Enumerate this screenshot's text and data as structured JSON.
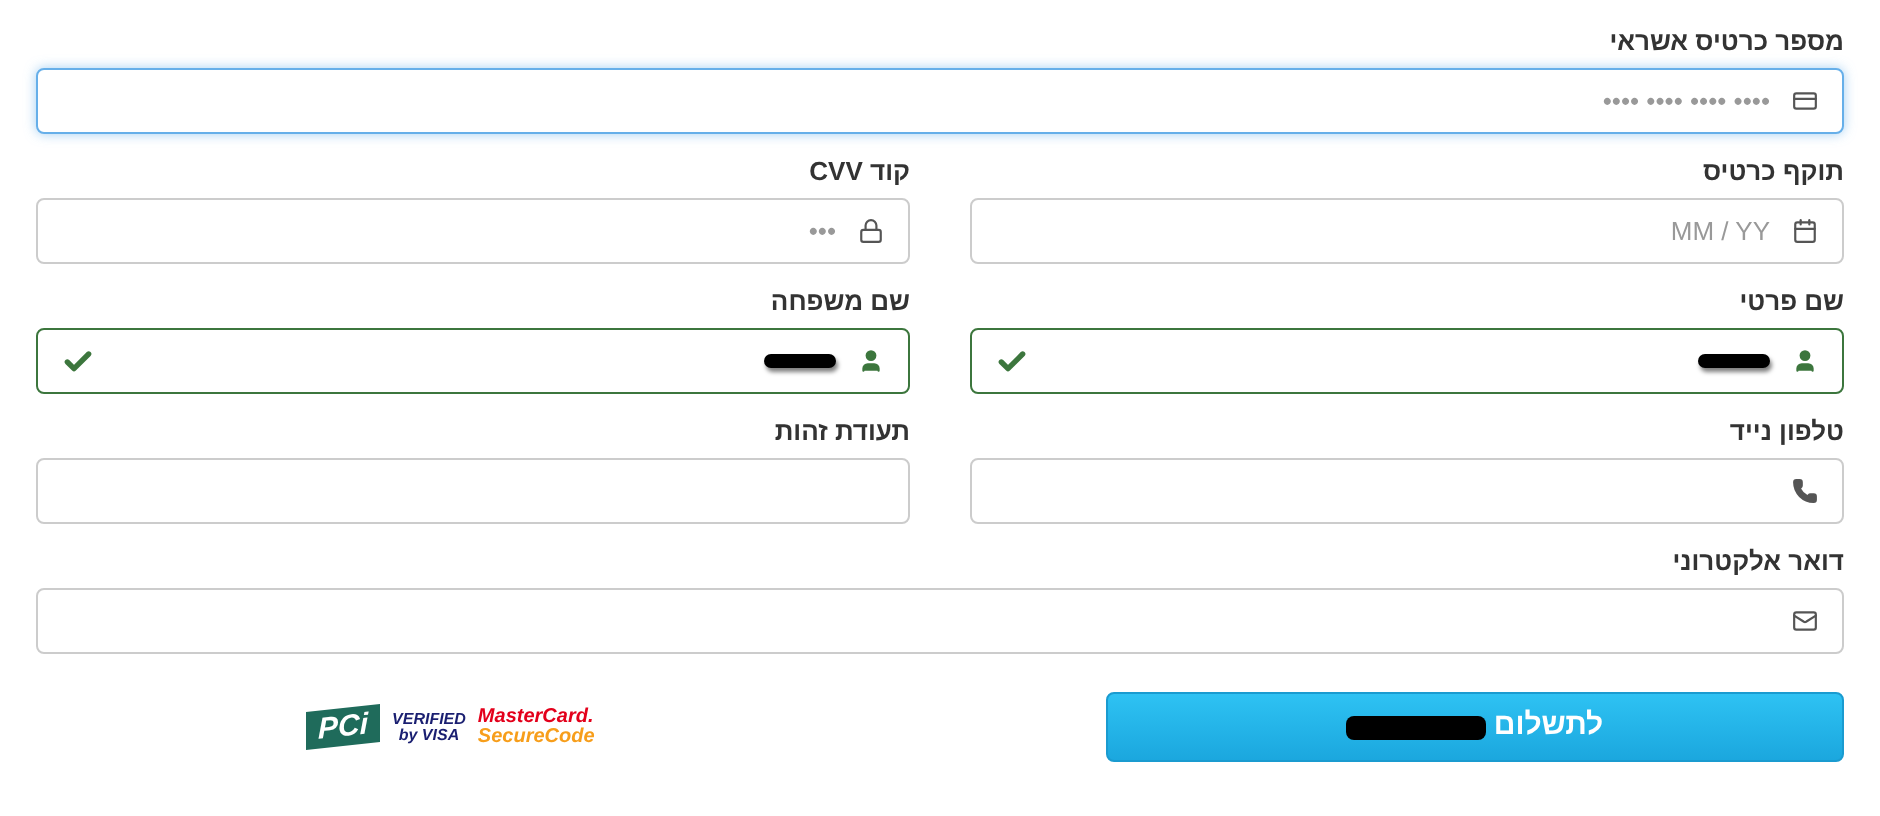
{
  "rows": [
    {
      "fields": [
        {
          "label": "מספר כרטיס אשראי",
          "kind": "card",
          "placeholder": "•••• •••• •••• ••••",
          "focused": true,
          "valid": false,
          "redacted": false
        }
      ]
    },
    {
      "fields": [
        {
          "label": "תוקף כרטיס",
          "kind": "expiry",
          "placeholder": "MM / YY",
          "focused": false,
          "valid": false,
          "redacted": false
        },
        {
          "label": "קוד CVV",
          "kind": "cvv",
          "placeholder": "•••",
          "focused": false,
          "valid": false,
          "redacted": false
        }
      ]
    },
    {
      "fields": [
        {
          "label": "שם פרטי",
          "kind": "name",
          "focused": false,
          "valid": true,
          "redacted": true
        },
        {
          "label": "שם משפחה",
          "kind": "name",
          "focused": false,
          "valid": true,
          "redacted": true
        }
      ]
    },
    {
      "fields": [
        {
          "label": "טלפון נייד",
          "kind": "phone",
          "focused": false,
          "valid": false,
          "redacted": false
        },
        {
          "label": "תעודת זהות",
          "kind": "id",
          "focused": false,
          "valid": false,
          "redacted": false
        }
      ]
    },
    {
      "fields": [
        {
          "label": "דואר אלקטרוני",
          "kind": "email",
          "focused": false,
          "valid": false,
          "redacted": false
        }
      ]
    }
  ],
  "pay_button": {
    "label": "לתשלום",
    "redacted": true
  },
  "badges": [
    {
      "kind": "mastercard",
      "text": "MasterCard.",
      "sub": "SecureCode"
    },
    {
      "kind": "visa",
      "text": "VERIFIED",
      "sub": "by VISA"
    },
    {
      "kind": "pci",
      "text": "PCi"
    }
  ]
}
